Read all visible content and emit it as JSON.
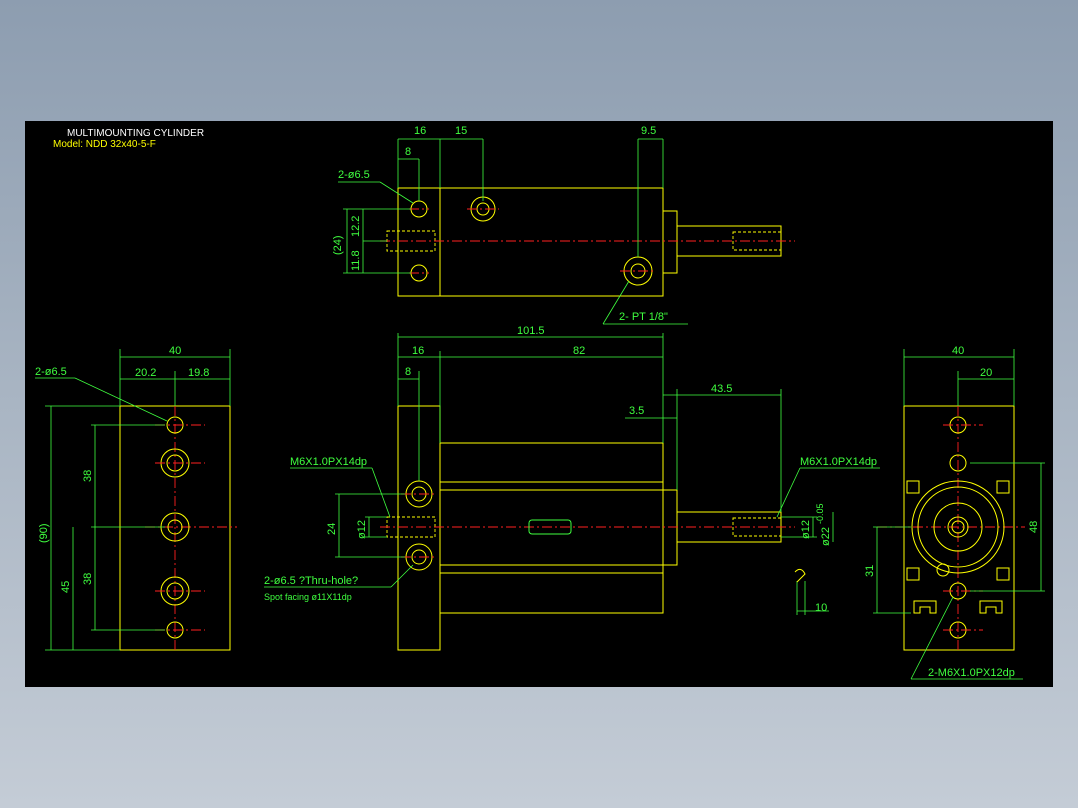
{
  "title": "MULTIMOUNTING CYLINDER",
  "model": "Model: NDD 32x40-5-F",
  "top_view": {
    "dims": {
      "d16": "16",
      "d15": "15",
      "d95": "9.5",
      "d8": "8",
      "d24p": "(24)",
      "d122": "12.2",
      "d118": "11.8"
    },
    "callouts": {
      "holes": "2-ø6.5",
      "port": "2- PT 1/8\""
    }
  },
  "left_view": {
    "dims": {
      "d40": "40",
      "d202": "20.2",
      "d198": "19.8",
      "d90p": "(90)",
      "d38a": "38",
      "d38b": "38",
      "d45": "45"
    },
    "callouts": {
      "holes": "2-ø6.5"
    }
  },
  "front_view": {
    "dims": {
      "d1015": "101.5",
      "d16": "16",
      "d82": "82",
      "d8": "8",
      "d435": "43.5",
      "d35": "3.5",
      "d24": "24",
      "d12a": "ø12",
      "d12b": "ø12",
      "d22": "ø22",
      "d22tol": "-0.05",
      "d10": "10"
    },
    "callouts": {
      "thread_left": "M6X1.0PX14dp",
      "thread_right": "M6X1.0PX14dp",
      "holes": "2-ø6.5 ?Thru-hole?",
      "spot": "Spot facing  ø11X11dp"
    }
  },
  "right_view": {
    "dims": {
      "d40": "40",
      "d20": "20",
      "d48": "48",
      "d31": "31"
    },
    "callouts": {
      "thread": "2-M6X1.0PX12dp"
    }
  },
  "colors": {
    "outline": "#ffff00",
    "dimension": "#3fff3f",
    "center": "#ff2020",
    "background": "#000000"
  }
}
